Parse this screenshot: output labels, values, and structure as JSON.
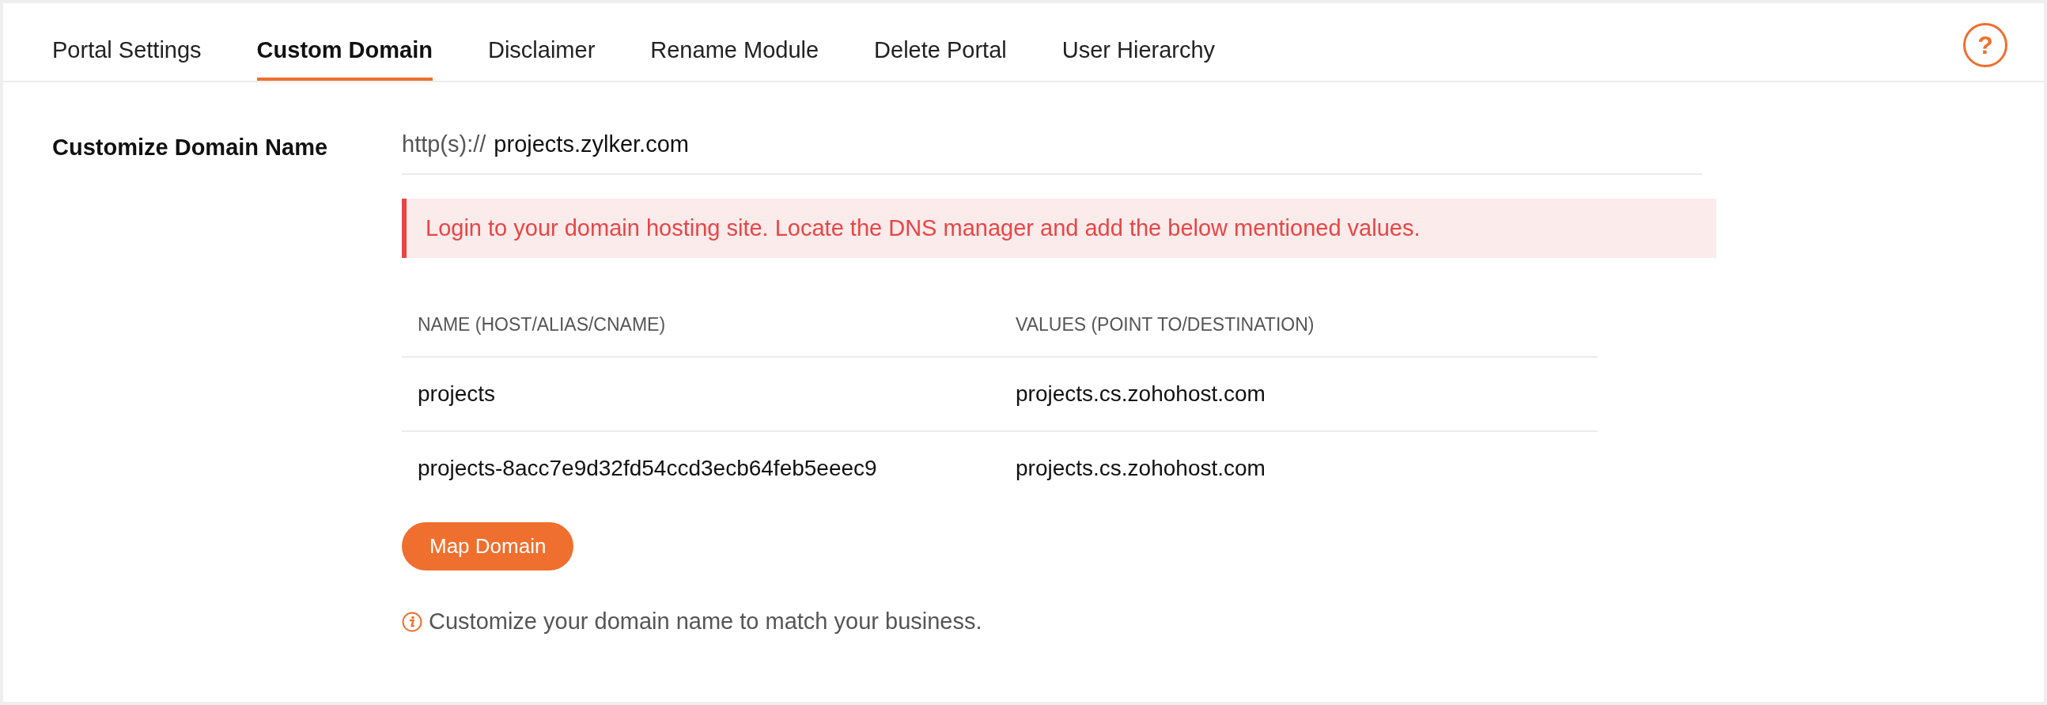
{
  "tabs": [
    {
      "label": "Portal Settings",
      "selected": false
    },
    {
      "label": "Custom Domain",
      "selected": true
    },
    {
      "label": "Disclaimer",
      "selected": false
    },
    {
      "label": "Rename Module",
      "selected": false
    },
    {
      "label": "Delete Portal",
      "selected": false
    },
    {
      "label": "User Hierarchy",
      "selected": false
    }
  ],
  "help_button": {
    "label": "?"
  },
  "domain": {
    "label": "Customize Domain Name",
    "prefix": "http(s)://",
    "value": "projects.zylker.com"
  },
  "alert": "Login to your domain hosting site. Locate the DNS manager and add the below mentioned values.",
  "table": {
    "columns": [
      "NAME (HOST/ALIAS/CNAME)",
      "VALUES (POINT TO/DESTINATION)"
    ],
    "rows": [
      [
        "projects",
        "projects.cs.zohohost.com"
      ],
      [
        "projects-8acc7e9d32fd54ccd3ecb64feb5eeec9",
        "projects.cs.zohohost.com"
      ]
    ]
  },
  "map_button": "Map Domain",
  "note": "Customize your domain name to match your business."
}
